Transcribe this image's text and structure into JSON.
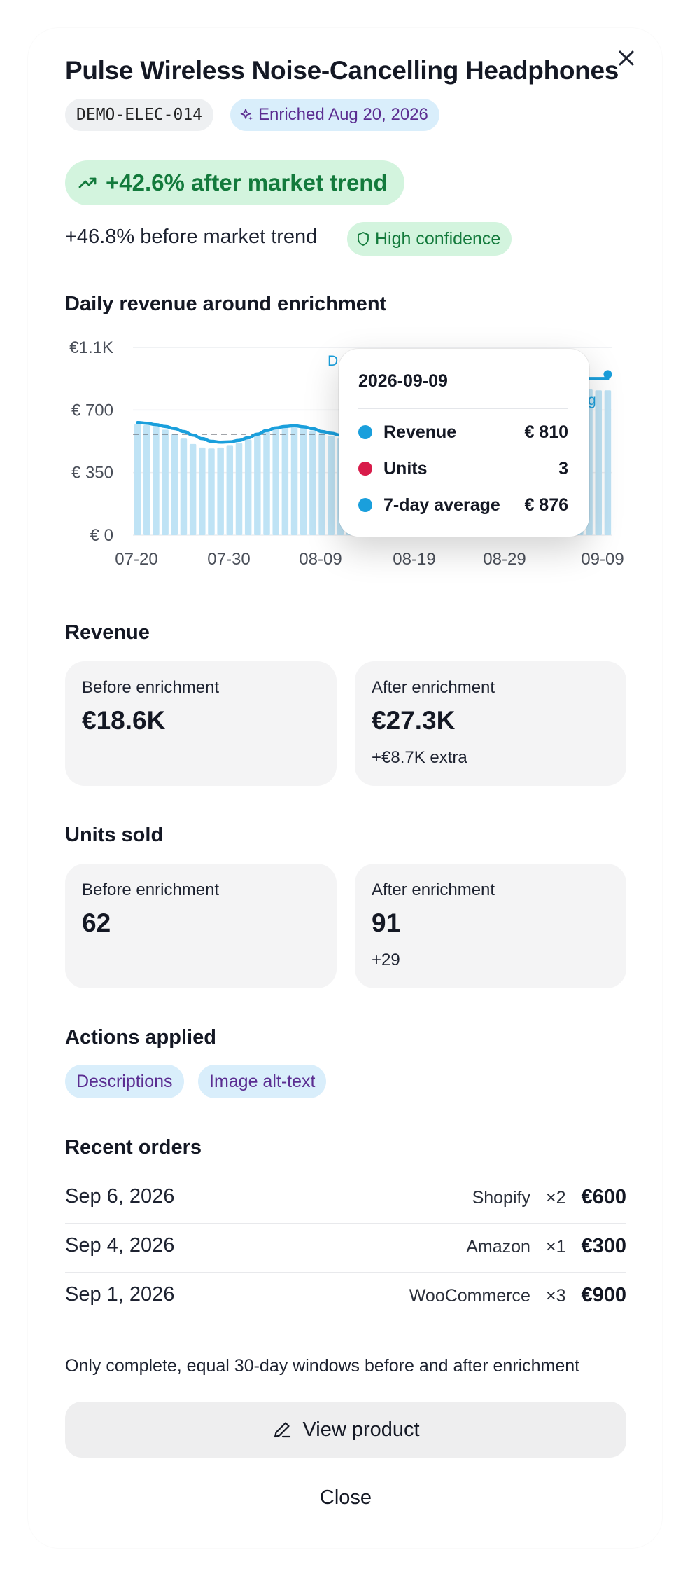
{
  "product": {
    "title": "Pulse Wireless Noise-Cancelling Headphones",
    "sku": "DEMO-ELEC-014",
    "enriched_label": "Enriched Aug 20, 2026"
  },
  "impact": {
    "after_trend": "+42.6% after market trend",
    "before_trend": "+46.8% before market trend",
    "confidence": "High confidence"
  },
  "chart_section": {
    "title": "Daily revenue around enrichment"
  },
  "chart_data": {
    "type": "bar",
    "title": "Daily revenue around enrichment",
    "y_ticks": [
      "€ 0",
      "€ 350",
      "€ 700",
      "€1.1K"
    ],
    "y_tick_values": [
      0,
      350,
      700,
      1050
    ],
    "ylim": [
      0,
      1050
    ],
    "x_ticks": [
      "07-20",
      "07-30",
      "08-09",
      "08-19",
      "08-29",
      "09-09"
    ],
    "x_range": [
      "2026-07-20",
      "2026-09-09"
    ],
    "series": [
      {
        "name": "Revenue",
        "kind": "bar",
        "color": "#bfe3f5",
        "dates": [
          "07-20",
          "07-21",
          "07-22",
          "07-23",
          "07-24",
          "07-25",
          "07-26",
          "07-27",
          "07-28",
          "07-29",
          "07-30",
          "07-31",
          "08-01",
          "08-02",
          "08-03",
          "08-04",
          "08-05",
          "08-06",
          "08-07",
          "08-08",
          "08-09",
          "08-10",
          "08-11",
          "08-12",
          "08-13",
          "08-14",
          "08-15",
          "08-16",
          "08-17",
          "08-18",
          "08-19",
          "08-20",
          "08-21",
          "08-22",
          "08-23",
          "08-24",
          "08-25",
          "08-26",
          "08-27",
          "08-28",
          "08-29",
          "08-30",
          "08-31",
          "09-01",
          "09-02",
          "09-03",
          "09-04",
          "09-05",
          "09-06",
          "09-07",
          "09-08",
          "09-09"
        ],
        "values": [
          620,
          615,
          605,
          590,
          565,
          540,
          510,
          490,
          485,
          490,
          500,
          515,
          535,
          560,
          590,
          605,
          615,
          610,
          600,
          585,
          570,
          555,
          540,
          530,
          560,
          600,
          640,
          680,
          720,
          760,
          790,
          810,
          820,
          830,
          840,
          850,
          860,
          860,
          865,
          870,
          870,
          875,
          880,
          870,
          860,
          850,
          840,
          830,
          820,
          815,
          810,
          810
        ]
      },
      {
        "name": "7-day average",
        "kind": "line",
        "color": "#1a9fdc",
        "values": [
          630,
          626,
          618,
          608,
          596,
          580,
          560,
          540,
          525,
          520,
          522,
          530,
          545,
          565,
          585,
          600,
          608,
          612,
          606,
          596,
          580,
          570,
          560,
          560,
          575,
          600,
          640,
          680,
          720,
          760,
          790,
          810,
          825,
          840,
          850,
          860,
          866,
          870,
          872,
          874,
          876,
          878,
          880,
          880,
          878,
          876,
          874,
          876,
          876,
          876,
          876,
          876
        ]
      },
      {
        "name": "Baseline",
        "kind": "dashed",
        "color": "#6b6f77",
        "values": [
          565
        ]
      }
    ],
    "annotations": [
      "D",
      "g"
    ],
    "grid": true
  },
  "tooltip": {
    "date": "2026-09-09",
    "rows": [
      {
        "label": "Revenue",
        "value": "€ 810",
        "color": "#1a9fdc"
      },
      {
        "label": "Units",
        "value": "3",
        "color": "#d81b4a"
      },
      {
        "label": "7-day average",
        "value": "€ 876",
        "color": "#1a9fdc"
      }
    ]
  },
  "revenue": {
    "title": "Revenue",
    "before_label": "Before enrichment",
    "before_value": "€18.6K",
    "after_label": "After enrichment",
    "after_value": "€27.3K",
    "after_extra": "+€8.7K extra"
  },
  "units": {
    "title": "Units sold",
    "before_label": "Before enrichment",
    "before_value": "62",
    "after_label": "After enrichment",
    "after_value": "91",
    "after_extra": "+29"
  },
  "actions": {
    "title": "Actions applied",
    "chips": [
      "Descriptions",
      "Image alt-text"
    ]
  },
  "orders": {
    "title": "Recent orders",
    "rows": [
      {
        "date": "Sep 6, 2026",
        "channel": "Shopify",
        "qty": "×2",
        "amount": "€600"
      },
      {
        "date": "Sep 4, 2026",
        "channel": "Amazon",
        "qty": "×1",
        "amount": "€300"
      },
      {
        "date": "Sep 1, 2026",
        "channel": "WooCommerce",
        "qty": "×3",
        "amount": "€900"
      }
    ]
  },
  "footer": {
    "note": "Only complete, equal 30-day windows before and after enrichment",
    "view_button": "View product",
    "close_button": "Close"
  },
  "colors": {
    "accent_blue": "#1a9fdc",
    "purple_text": "#5b2d91",
    "green_text": "#137a3c",
    "green_bg": "#d3f4de",
    "blue_bg": "#d9eefb"
  }
}
